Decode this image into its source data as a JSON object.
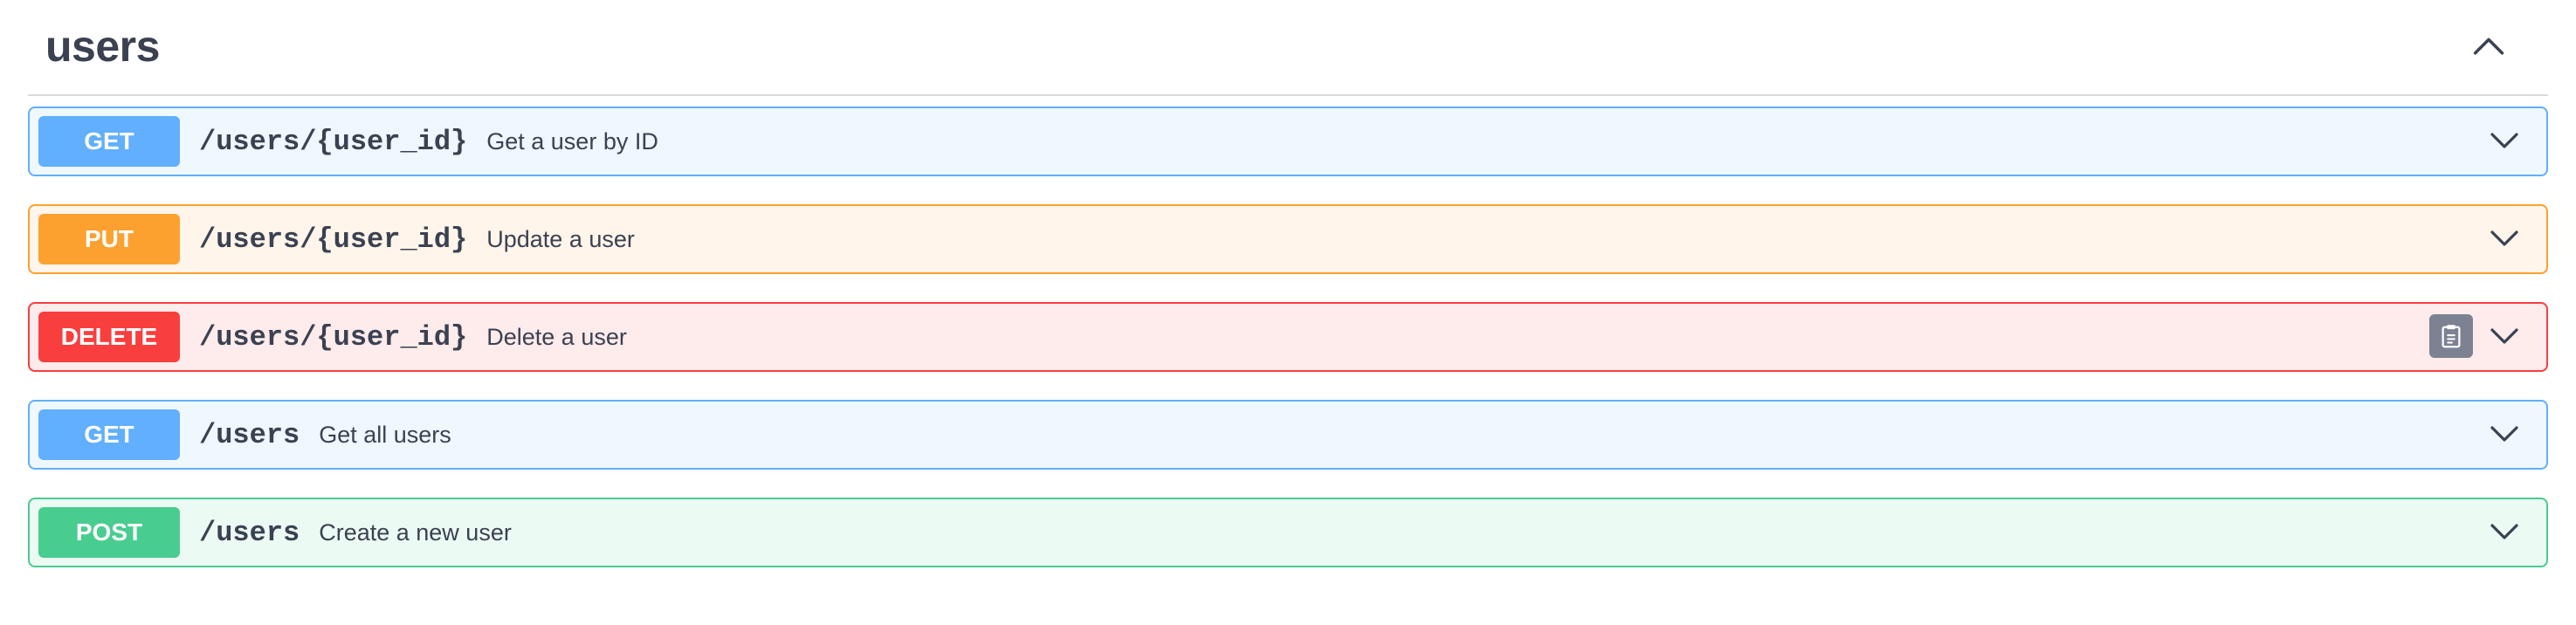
{
  "tag": {
    "title": "users",
    "toggle_icon": "chevron-up-icon"
  },
  "operations": [
    {
      "method": "GET",
      "path": "/users/{user_id}",
      "summary": "Get a user by ID",
      "expand_icon": "chevron-down-icon"
    },
    {
      "method": "PUT",
      "path": "/users/{user_id}",
      "summary": "Update a user",
      "expand_icon": "chevron-down-icon"
    },
    {
      "method": "DELETE",
      "path": "/users/{user_id}",
      "summary": "Delete a user",
      "expand_icon": "chevron-down-icon",
      "copy_icon": "clipboard-copy-icon"
    },
    {
      "method": "GET",
      "path": "/users",
      "summary": "Get all users",
      "expand_icon": "chevron-down-icon"
    },
    {
      "method": "POST",
      "path": "/users",
      "summary": "Create a new user",
      "expand_icon": "chevron-down-icon"
    }
  ],
  "colors": {
    "get": "#61affe",
    "put": "#fca130",
    "delete": "#f93e3e",
    "post": "#49cc90",
    "copy_button": "#7d8293",
    "text": "#3b4151"
  }
}
